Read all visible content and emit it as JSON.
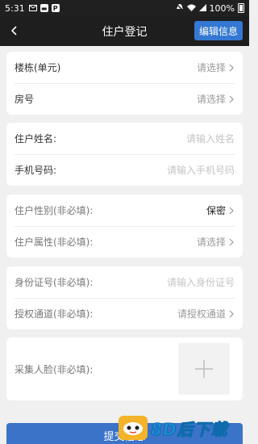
{
  "statusbar": {
    "time": "5:31",
    "battery": "100%",
    "notif_icons": [
      "mail-icon",
      "clipboard-icon",
      "p-app-icon"
    ]
  },
  "nav": {
    "title": "住户登记",
    "edit_label": "编辑信息"
  },
  "section1": {
    "building_label": "楼栋(单元)",
    "building_value": "请选择",
    "room_label": "房号",
    "room_value": "请选择"
  },
  "section2": {
    "name_label": "住户姓名:",
    "name_placeholder": "请输入姓名",
    "phone_label": "手机号码:",
    "phone_placeholder": "请输入手机号码"
  },
  "section3": {
    "gender_label": "住户性别(非必填):",
    "gender_value": "保密",
    "attr_label": "住户属性(非必填):",
    "attr_value": "请选择"
  },
  "section4": {
    "id_label": "身份证号(非必填):",
    "id_placeholder": "请输入身份证号",
    "channel_label": "授权通道(非必填):",
    "channel_value": "请授权通道"
  },
  "section5": {
    "face_label": "采集人脸(非必填):"
  },
  "submit_label": "提交信息",
  "watermark_text": "8D后下载",
  "colors": {
    "accent": "#3478d4",
    "navbar": "#1e1e1e",
    "background": "#f0f0f0"
  }
}
